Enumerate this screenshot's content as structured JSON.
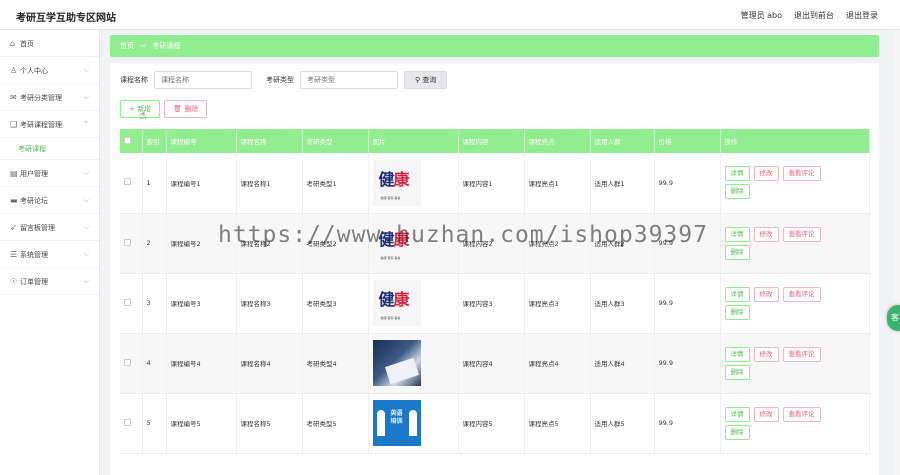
{
  "app": {
    "title": "考研互学互助专区网站"
  },
  "topbar": {
    "admin_label": "管理员 abo",
    "exit_front": "退出到前台",
    "logout": "退出登录"
  },
  "sidebar": {
    "items": [
      {
        "label": "首页",
        "icon": "home-icon",
        "glyph": "⌂"
      },
      {
        "label": "个人中心",
        "icon": "user-icon",
        "glyph": "♙",
        "chev": "⌵"
      },
      {
        "label": "考研分类管理",
        "icon": "mail-icon",
        "glyph": "✉",
        "chev": "⌵"
      },
      {
        "label": "考研课程管理",
        "icon": "course-icon",
        "glyph": "❑",
        "chev": "⌃"
      },
      {
        "label": "考研课程",
        "sub": true
      },
      {
        "label": "用户管理",
        "icon": "users-icon",
        "glyph": "▤",
        "chev": "⌵"
      },
      {
        "label": "考研论坛",
        "icon": "forum-icon",
        "glyph": "▬",
        "chev": "⌵"
      },
      {
        "label": "留言板管理",
        "icon": "send-icon",
        "glyph": "➶",
        "chev": "⌵"
      },
      {
        "label": "系统管理",
        "icon": "system-icon",
        "glyph": "☰",
        "chev": "⌵"
      },
      {
        "label": "订单管理",
        "icon": "order-icon",
        "glyph": "☉",
        "chev": "⌵"
      }
    ]
  },
  "breadcrumb": {
    "home": "首页",
    "arrow": "→",
    "current": "考研课程"
  },
  "search": {
    "name_label": "课程名称",
    "name_placeholder": "课程名称",
    "type_label": "考研类型",
    "type_placeholder": "考研类型",
    "button": "查询",
    "button_icon": "search-icon"
  },
  "actions": {
    "add": "+ 新增",
    "delete": "删除"
  },
  "table": {
    "headers": [
      "",
      "索引",
      "课程编号",
      "课程名称",
      "考研类型",
      "图片",
      "课程内容",
      "课程亮点",
      "适用人群",
      "价格",
      "操作"
    ],
    "rows": [
      {
        "index": "1",
        "code": "课程编号1",
        "name": "课程名称1",
        "type": "考研类型1",
        "image": "t1",
        "content": "课程内容1",
        "highlight": "课程亮点1",
        "audience": "适用人群1",
        "price": "99.9"
      },
      {
        "index": "2",
        "code": "课程编号2",
        "name": "课程名称2",
        "type": "考研类型2",
        "image": "t1",
        "content": "课程内容2",
        "highlight": "课程亮点2",
        "audience": "适用人群2",
        "price": "99.9"
      },
      {
        "index": "3",
        "code": "课程编号3",
        "name": "课程名称3",
        "type": "考研类型3",
        "image": "t1",
        "content": "课程内容3",
        "highlight": "课程亮点3",
        "audience": "适用人群3",
        "price": "99.9"
      },
      {
        "index": "4",
        "code": "课程编号4",
        "name": "课程名称4",
        "type": "考研类型4",
        "image": "t2",
        "content": "课程内容4",
        "highlight": "课程亮点4",
        "audience": "适用人群4",
        "price": "99.9"
      },
      {
        "index": "5",
        "code": "课程编号5",
        "name": "课程名称5",
        "type": "考研类型5",
        "image": "t3",
        "content": "课程内容5",
        "highlight": "课程亮点5",
        "audience": "适用人群5",
        "price": "99.9"
      }
    ],
    "ops": {
      "detail": "详情",
      "edit": "修改",
      "comments": "查看评论",
      "delete": "删除"
    }
  },
  "image_text": {
    "logo_a": "健",
    "logo_b": "康",
    "caption": "健康 营养 美食",
    "english_a": "英语",
    "english_b": "培训"
  },
  "watermark": "https://www.huzhan.com/ishop39397",
  "float_button": "客",
  "colors": {
    "accent": "#90ee90",
    "accent_text": "#58b858",
    "danger": "#e0607e"
  }
}
